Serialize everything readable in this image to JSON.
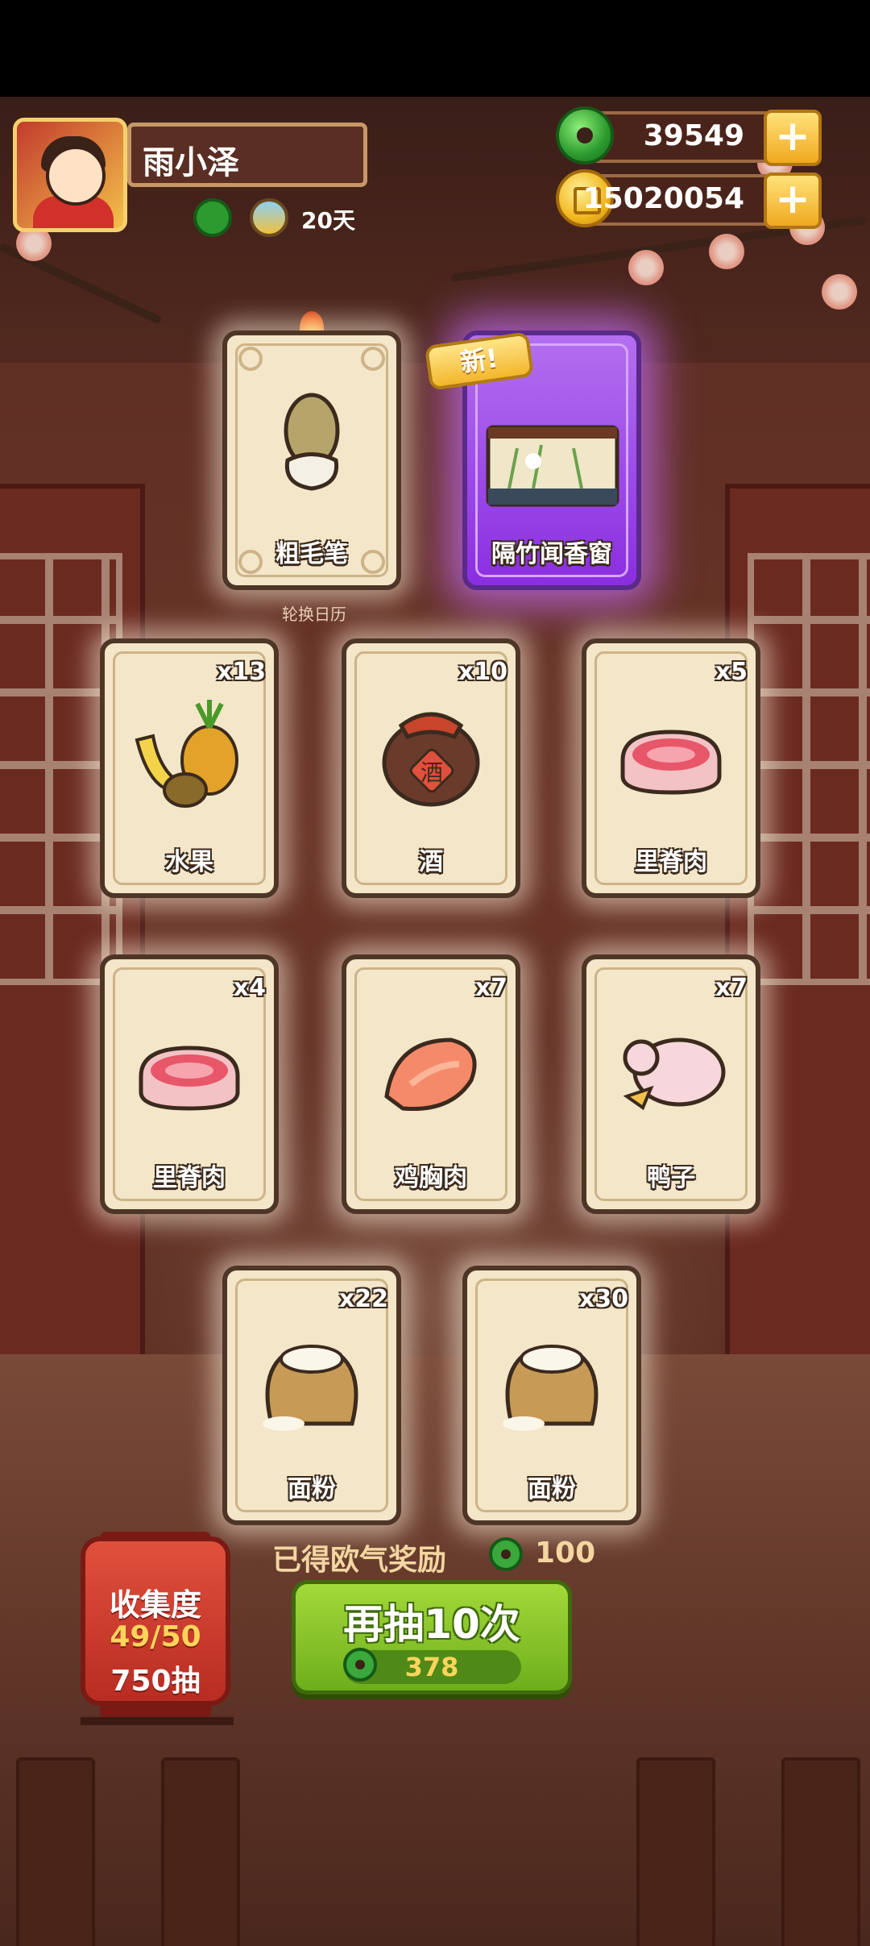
{
  "player": {
    "name": "雨小泽",
    "days": "20天"
  },
  "resources": {
    "jade": "39549",
    "coins": "15020054"
  },
  "featured_cards": [
    {
      "label": "粗毛笔",
      "art": "brush-icon"
    },
    {
      "label": "隔竹闻香窗",
      "art": "window-painting-icon",
      "badge": "新!"
    }
  ],
  "featured_caption": "轮换日历",
  "cards": [
    {
      "label": "水果",
      "count": "x13",
      "art": "fruit-icon"
    },
    {
      "label": "酒",
      "count": "x10",
      "art": "wine-jar-icon",
      "jar_char": "酒"
    },
    {
      "label": "里脊肉",
      "count": "x5",
      "art": "tenderloin-icon"
    },
    {
      "label": "里脊肉",
      "count": "x4",
      "art": "tenderloin-icon"
    },
    {
      "label": "鸡胸肉",
      "count": "x7",
      "art": "chicken-breast-icon"
    },
    {
      "label": "鸭子",
      "count": "x7",
      "art": "duck-icon"
    },
    {
      "label": "面粉",
      "count": "x22",
      "art": "flour-sack-icon"
    },
    {
      "label": "面粉",
      "count": "x30",
      "art": "flour-sack-icon"
    }
  ],
  "collection": {
    "title": "收集度",
    "progress": "49/50",
    "draws": "750抽"
  },
  "reward": {
    "label": "已得欧气奖励",
    "value": "100"
  },
  "draw_button": {
    "label": "再抽10次",
    "cost": "378"
  },
  "colors": {
    "card_bg": "#f4e6c8",
    "card_border": "#4e3627",
    "special_card": "#9b3ee8",
    "button_green": "#8cc82a",
    "lantern_red": "#c93a2c"
  }
}
